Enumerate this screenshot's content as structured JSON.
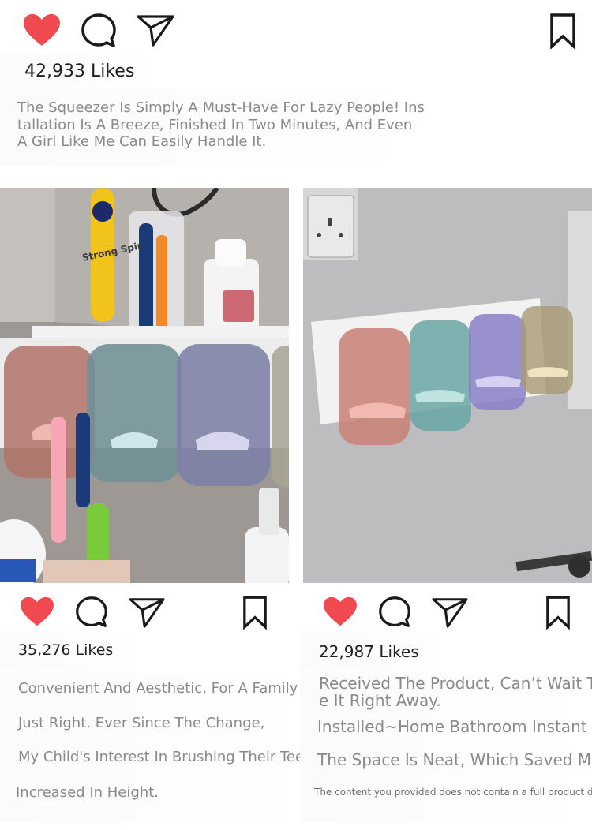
{
  "colors": {
    "heart": "#f0494f",
    "icon_stroke": "#1a1a1a",
    "caption": "#8a8a8a",
    "likes": "#1f1f1f"
  },
  "icons": {
    "like": "heart-icon",
    "comment": "comment-icon",
    "share": "send-icon",
    "save": "bookmark-icon"
  },
  "top_post": {
    "likes": "42,933 Likes",
    "caption_lines": [
      "The Squeezer Is Simply A Must-Have For Lazy People! Ins",
      "tallation Is A Breeze, Finished In Two Minutes, And Even",
      "A Girl Like Me Can Easily Handle It."
    ]
  },
  "left_post": {
    "photo_text": "Strong Spin",
    "likes": "35,276 Likes",
    "caption_lines": [
      "Convenient And Aesthetic, For A Family Of Four",
      "Just Right. Ever Since The Change,",
      "My Child's Interest In Brushing Their Teeth",
      "Increased In Height."
    ]
  },
  "right_post": {
    "likes": "22,987 Likes",
    "caption_lines": [
      "Received The Product, Can’t Wait To",
      "e It Right Away.",
      "Installed~Home Bathroom Instant",
      "The Space Is Neat, Which Saved Me",
      "The content you provided does not contain a full product description"
    ]
  }
}
